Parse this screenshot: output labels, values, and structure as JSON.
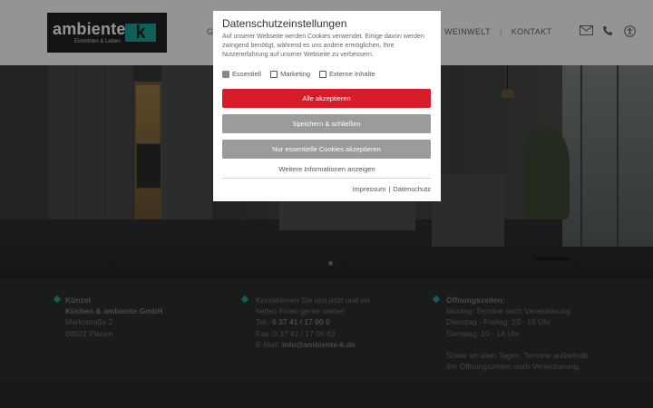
{
  "header": {
    "logo_text": "ambiente",
    "logo_sub": "Einrichten & Leben",
    "logo_k": "k",
    "nav_partial": "G",
    "nav": [
      {
        "label": "WEINWELT"
      },
      {
        "label": "KONTAKT"
      }
    ],
    "icons": [
      "mail-icon",
      "phone-icon",
      "accessibility-icon"
    ]
  },
  "footer": {
    "address": {
      "line1": "Künzel",
      "line2": "Küchen & ambiente GmbH",
      "line3": "Marktstraße 2",
      "line4": "08523 Plauen"
    },
    "contact": {
      "line1": "Kontaktieren Sie uns jetzt und wir",
      "line2": "helfen Ihnen gerne weiter!",
      "tel_label": "Tel.: ",
      "tel": "0 37 41 / 17 00 0",
      "fax": "Fax: 0 37 41 / 17 00 63",
      "email_label": "E-Mail: ",
      "email": "info@ambiente-k.de"
    },
    "hours": {
      "title": "Öffnungszeiten:",
      "line1": "Montag: Termine nach Vereinbarung",
      "line2": "Dienstag - Freitag: 10 - 18 Uhr",
      "line3": "Samstag: 10 - 14 Uhr",
      "line4": "Sowie an allen Tagen: Termine außerhalb",
      "line5": "der Öffnungszeiten nach Vereinbarung."
    }
  },
  "cookie_dialog": {
    "title": "Datenschutzeinstellungen",
    "text": "Auf unserer Webseite werden Cookies verwendet. Einige davon werden zwingend benötigt, während es uns andere ermöglichen, Ihre Nutzererfahrung auf unserer Webseite zu verbessern.",
    "options": [
      {
        "label": "Essentiell",
        "checked": true
      },
      {
        "label": "Marketing",
        "checked": false
      },
      {
        "label": "Externe Inhalte",
        "checked": false
      }
    ],
    "accept_all": "Alle akzeptieren",
    "save_close": "Speichern & schließen",
    "essential_only": "Nur essentielle Cookies akzeptieren",
    "more_info": "Weitere Informationen anzeigen",
    "imprint": "Impressum",
    "separator": "|",
    "privacy": "Datenschutz",
    "colors": {
      "accept": "#d61c2a",
      "secondary": "#9b9b9b",
      "accent": "#1aa39a"
    }
  }
}
